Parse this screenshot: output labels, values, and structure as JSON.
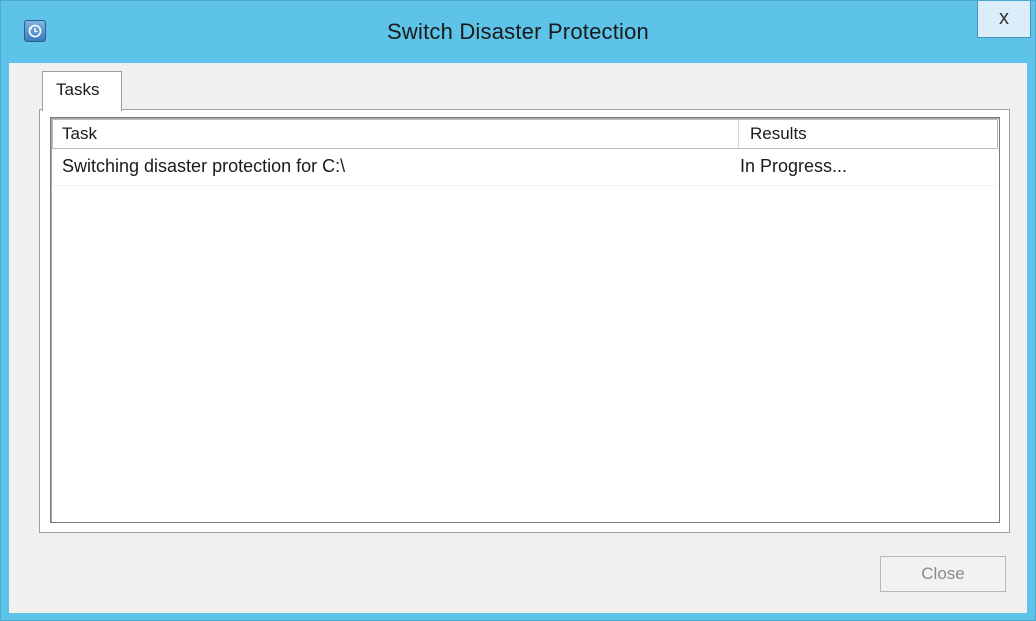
{
  "window": {
    "title": "Switch Disaster Protection",
    "close_glyph": "x",
    "icon": "backup-clock-icon"
  },
  "tabs": [
    {
      "label": "Tasks"
    }
  ],
  "list": {
    "columns": [
      "Task",
      "Results"
    ],
    "rows": [
      {
        "task": "Switching disaster protection for C:\\",
        "result": "In Progress..."
      }
    ]
  },
  "footer": {
    "close_label": "Close",
    "close_enabled": false
  },
  "colors": {
    "frame": "#5ec3e8",
    "client": "#f0f0f0"
  }
}
